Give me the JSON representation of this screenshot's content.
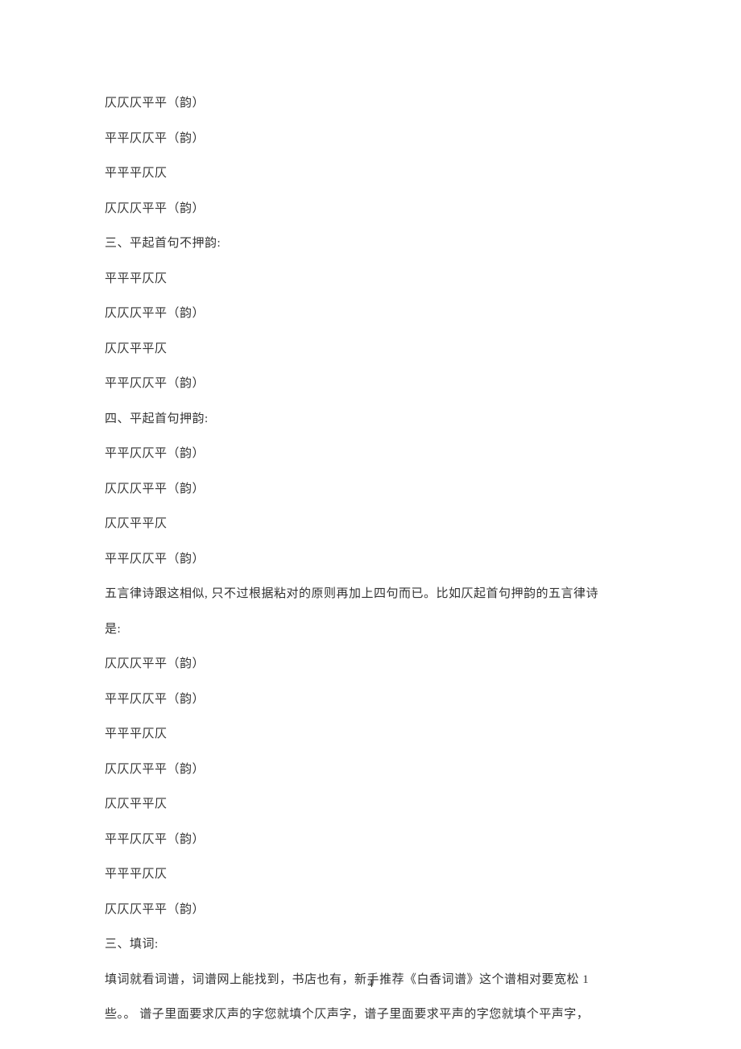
{
  "lines": [
    "仄仄仄平平（韵）",
    "平平仄仄平（韵）",
    "平平平仄仄",
    "仄仄仄平平（韵）",
    "三、平起首句不押韵:",
    "平平平仄仄",
    "仄仄仄平平（韵）",
    "仄仄平平仄",
    "平平仄仄平（韵）",
    "四、平起首句押韵:",
    "平平仄仄平（韵）",
    "仄仄仄平平（韵）",
    "仄仄平平仄",
    "平平仄仄平（韵）",
    "五言律诗跟这相似, 只不过根据粘对的原则再加上四句而已。比如仄起首句押韵的五言律诗",
    "是:",
    "仄仄仄平平（韵）",
    "平平仄仄平（韵）",
    "平平平仄仄",
    "仄仄仄平平（韵）",
    "仄仄平平仄",
    "平平仄仄平（韵）",
    "平平平仄仄",
    "仄仄仄平平（韵）",
    "三、填词:",
    "填词就看词谱，词谱网上能找到，书店也有，新手推荐《白香词谱》这个谱相对要宽松 1",
    "些。。 谱子里面要求仄声的字您就填个仄声字，谱子里面要求平声的字您就填个平声字，"
  ],
  "page_number": "4"
}
